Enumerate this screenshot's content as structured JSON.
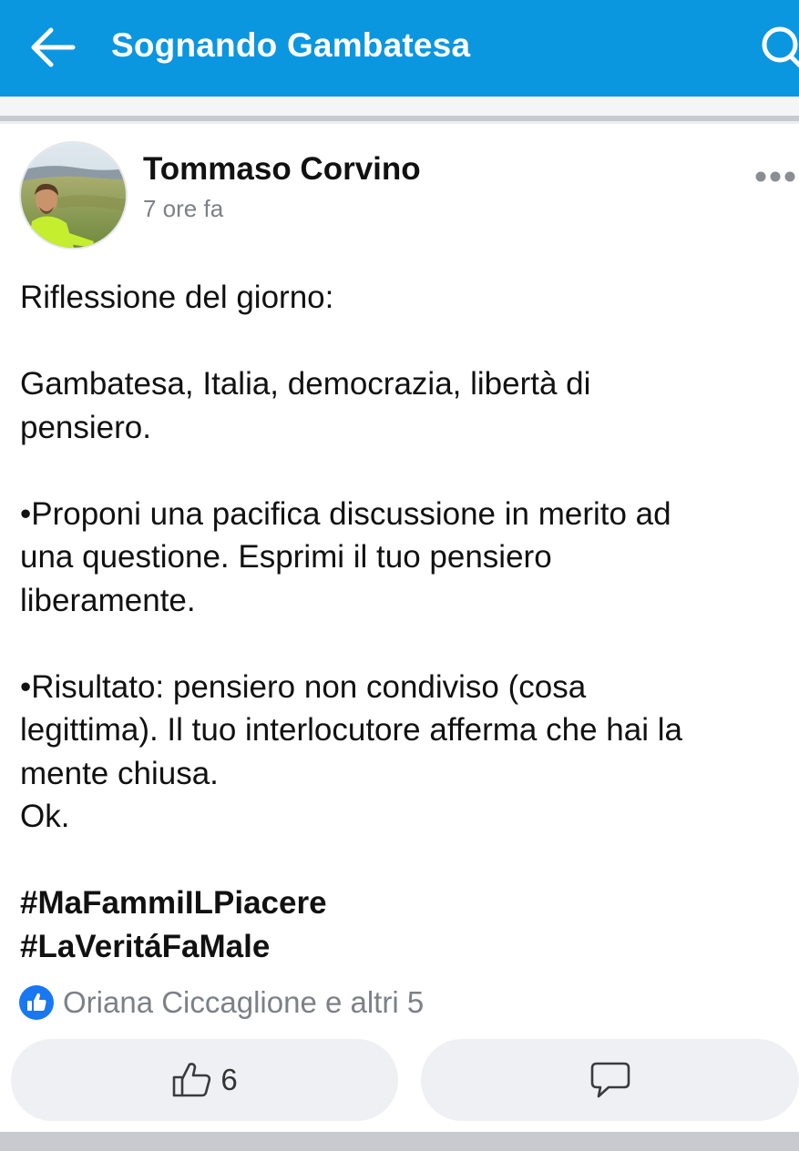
{
  "header": {
    "title": "Sognando Gambatesa",
    "back_icon": "arrow-left-icon",
    "search_icon": "search-icon",
    "background_color": "#0b96e0"
  },
  "post": {
    "author": "Tommaso Corvino",
    "time": "7 ore fa",
    "more_icon": "more-horizontal-icon",
    "body_lines": [
      "Riflessione del giorno:",
      "",
      "Gambatesa, Italia, democrazia, libertà di",
      "pensiero.",
      "",
      "•Proponi una pacifica discussione in merito ad",
      "una questione. Esprimi il tuo pensiero",
      "liberamente.",
      "",
      "•Risultato: pensiero non condiviso (cosa",
      "legittima). Il tuo interlocutore afferma che hai la",
      "mente chiusa.",
      "Ok.",
      ""
    ],
    "hashtags": [
      "#MaFammiILPiacere",
      "#LaVeritáFaMale"
    ],
    "reactions_text": "Oriana Ciccaglione e altri 5",
    "like_count": "6",
    "like_badge_color": "#1877f2"
  }
}
